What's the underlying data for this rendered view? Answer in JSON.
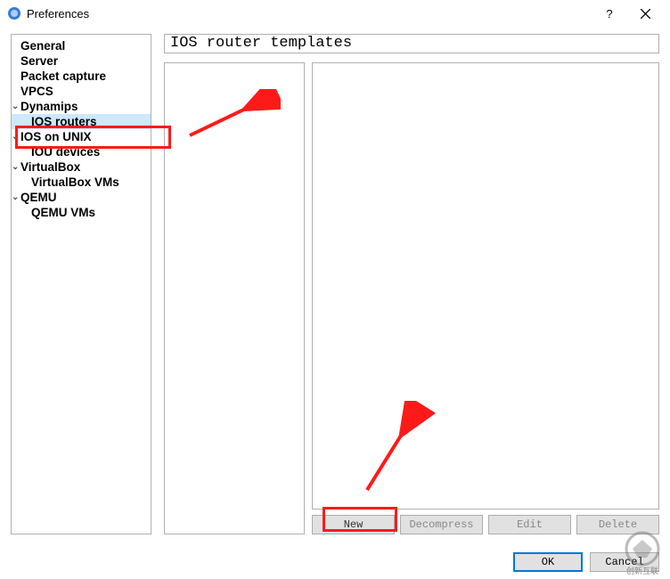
{
  "window": {
    "title": "Preferences",
    "help": "?",
    "close": "×"
  },
  "sidebar": {
    "items": [
      {
        "label": "General",
        "child": false,
        "expandable": false,
        "selected": false
      },
      {
        "label": "Server",
        "child": false,
        "expandable": false,
        "selected": false
      },
      {
        "label": "Packet capture",
        "child": false,
        "expandable": false,
        "selected": false
      },
      {
        "label": "VPCS",
        "child": false,
        "expandable": false,
        "selected": false
      },
      {
        "label": "Dynamips",
        "child": false,
        "expandable": true,
        "selected": false
      },
      {
        "label": "IOS routers",
        "child": true,
        "expandable": false,
        "selected": true
      },
      {
        "label": "IOS on UNIX",
        "child": false,
        "expandable": true,
        "selected": false
      },
      {
        "label": "IOU devices",
        "child": true,
        "expandable": false,
        "selected": false
      },
      {
        "label": "VirtualBox",
        "child": false,
        "expandable": true,
        "selected": false
      },
      {
        "label": "VirtualBox VMs",
        "child": true,
        "expandable": false,
        "selected": false
      },
      {
        "label": "QEMU",
        "child": false,
        "expandable": true,
        "selected": false
      },
      {
        "label": "QEMU VMs",
        "child": true,
        "expandable": false,
        "selected": false
      }
    ]
  },
  "main": {
    "title": "IOS router templates",
    "buttons": {
      "new": "New",
      "decompress": "Decompress",
      "edit": "Edit",
      "delete": "Delete"
    }
  },
  "footer": {
    "ok": "OK",
    "cancel": "Cancel"
  },
  "watermark": {
    "text": "创新互联"
  }
}
